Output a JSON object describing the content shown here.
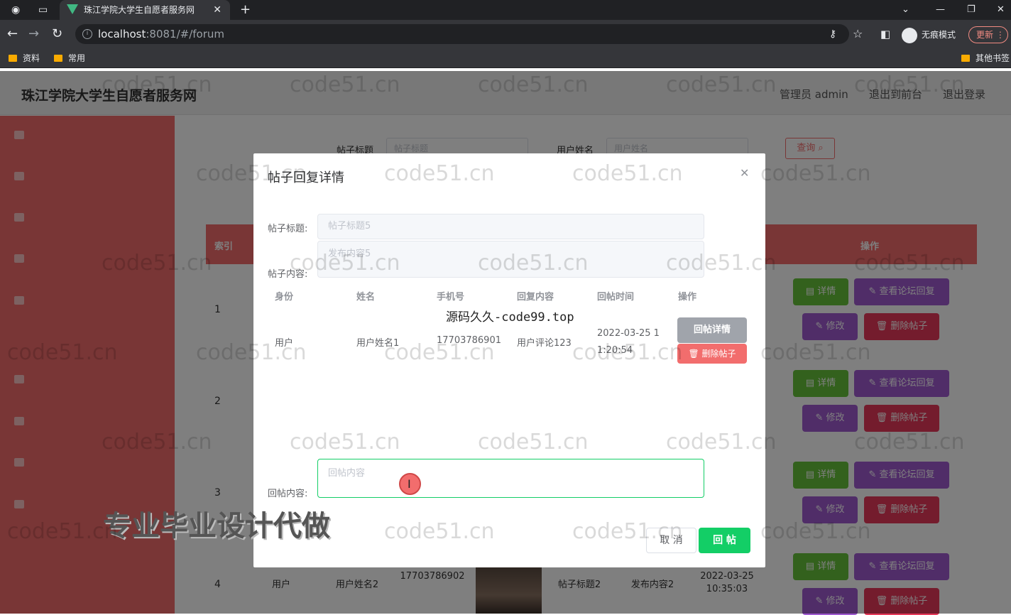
{
  "browser": {
    "tab_title": "珠江学院大学生自愿者服务网",
    "url_host": "localhost",
    "url_rest": ":8081/#/forum",
    "incognito_label": "无痕模式",
    "update_label": "更新",
    "bookmarks": [
      "资料",
      "常用"
    ],
    "other_bookmarks": "其他书签"
  },
  "header": {
    "site_title": "珠江学院大学生自愿者服务网",
    "admin_label": "管理员 admin",
    "front_link": "退出到前台",
    "logout_link": "退出登录"
  },
  "search": {
    "title_label": "帖子标题",
    "title_placeholder": "帖子标题",
    "user_label": "用户姓名",
    "user_placeholder": "用户姓名",
    "query_button": "查询"
  },
  "table": {
    "headers": {
      "index": "索引",
      "actions": "操作"
    },
    "rows": [
      {
        "index": "1"
      },
      {
        "index": "2"
      },
      {
        "index": "3"
      },
      {
        "index": "4",
        "identity": "用户",
        "name": "用户姓名2",
        "phone": "17703786902",
        "title": "帖子标题2",
        "content": "发布内容2",
        "time": "2022-03-25 10:35:03"
      }
    ],
    "btn_detail": "详情",
    "btn_view_reply": "查看论坛回复",
    "btn_edit": "修改",
    "btn_delete": "删除帖子"
  },
  "modal": {
    "title": "帖子回复详情",
    "post_title_label": "帖子标题:",
    "post_title_value": "帖子标题5",
    "post_content_label": "帖子内容:",
    "post_content_value": "发布内容5",
    "columns": [
      "身份",
      "姓名",
      "手机号",
      "回复内容",
      "回帖时间",
      "操作"
    ],
    "reply_row": {
      "identity": "用户",
      "name": "用户姓名1",
      "phone": "17703786901",
      "content": "用户评论123",
      "time": "2022-03-25 11:20:54",
      "detail_btn": "回帖详情",
      "delete_btn": "删除帖子"
    },
    "reply_label": "回帖内容:",
    "reply_placeholder": "回帖内容",
    "cancel_button": "取 消",
    "submit_button": "回 帖"
  },
  "overlay_text": {
    "watermark": "code51.cn",
    "center_text": "源码久久-code99.top",
    "promo": "专业毕业设计代做"
  }
}
